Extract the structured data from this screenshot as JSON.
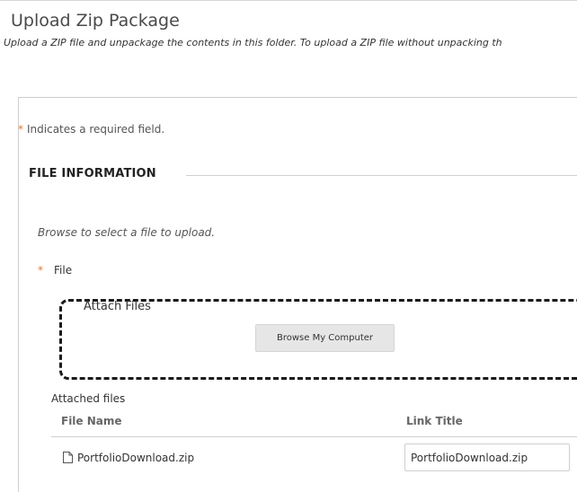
{
  "header": {
    "title": "Upload Zip Package",
    "subtitle": "Upload a ZIP file and unpackage the contents in this folder. To upload a ZIP file without unpacking th"
  },
  "form": {
    "required_star": "*",
    "required_note": "Indicates a required field.",
    "section_title": "FILE INFORMATION",
    "browse_hint": "Browse to select a file to upload.",
    "file_label": "File",
    "attach_label": "Attach Files",
    "browse_button": "Browse My Computer"
  },
  "attached": {
    "title": "Attached files",
    "columns": [
      "File Name",
      "Link Title"
    ],
    "rows": [
      {
        "file_name": "PortfolioDownload.zip",
        "link_title": "PortfolioDownload.zip",
        "icon": "document-icon"
      }
    ]
  },
  "colors": {
    "required": "#e07a33",
    "dropzone_border": "#1a1a1a",
    "button_bg": "#e6e6e6"
  }
}
